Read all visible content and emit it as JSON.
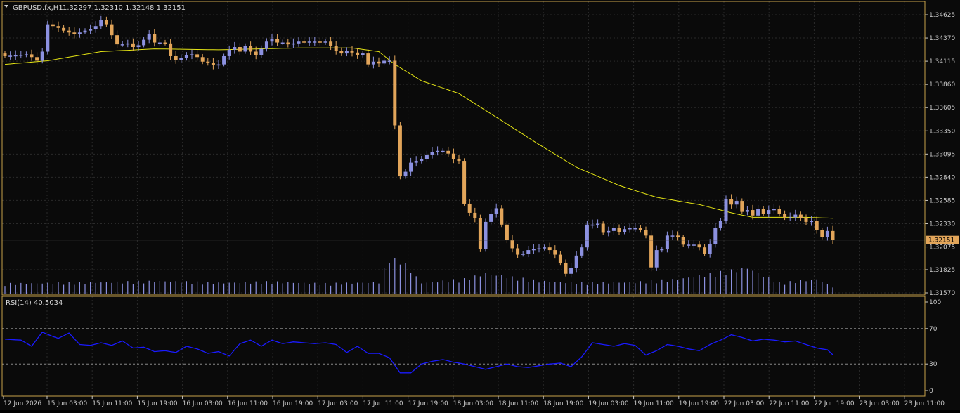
{
  "header": {
    "symbol": "GBPUSD.fx,H1",
    "ohlc": "1.32297 1.32310 1.32148 1.32151"
  },
  "colors": {
    "background": "#0a0a0a",
    "frame": "#c8a24a",
    "grid": "#2b2b2b",
    "axis_text": "#c8c8c8",
    "bull": "#8c91e0",
    "bear": "#e2a55a",
    "ma": "#e6e614",
    "rsi": "#1a1aff",
    "price_line": "#3a3a3a",
    "price_tag_bg": "#e2a55a"
  },
  "chart_data": [
    {
      "type": "candlestick",
      "symbol": "GBPUSD.fx",
      "timeframe": "H1",
      "current_price": "1.32151",
      "y_tick_labels": [
        "1.34625",
        "1.34370",
        "1.34115",
        "1.33860",
        "1.33605",
        "1.33350",
        "1.33095",
        "1.32840",
        "1.32585",
        "1.32330",
        "1.32075",
        "1.31825",
        "1.31570"
      ],
      "ylim": [
        1.3157,
        1.3471
      ],
      "x_tick_labels": [
        "12 Jun 2026",
        "15 Jun 03:00",
        "15 Jun 11:00",
        "15 Jun 19:00",
        "16 Jun 03:00",
        "16 Jun 11:00",
        "16 Jun 19:00",
        "17 Jun 03:00",
        "17 Jun 11:00",
        "17 Jun 19:00",
        "18 Jun 03:00",
        "18 Jun 11:00",
        "18 Jun 19:00",
        "19 Jun 03:00",
        "19 Jun 11:00",
        "19 Jun 19:00",
        "22 Jun 03:00",
        "22 Jun 11:00",
        "22 Jun 19:00",
        "23 Jun 03:00",
        "23 Jun 11:00"
      ],
      "close_path": [
        [
          0,
          1.3417
        ],
        [
          2,
          1.3418
        ],
        [
          4,
          1.3419
        ],
        [
          5,
          1.3416
        ],
        [
          6,
          1.3412
        ],
        [
          7,
          1.3422
        ],
        [
          8,
          1.3452
        ],
        [
          10,
          1.3448
        ],
        [
          11,
          1.3445
        ],
        [
          13,
          1.3441
        ],
        [
          15,
          1.3445
        ],
        [
          16,
          1.3447
        ],
        [
          17,
          1.345
        ],
        [
          18,
          1.3457
        ],
        [
          19,
          1.3452
        ],
        [
          20,
          1.344
        ],
        [
          21,
          1.343
        ],
        [
          22,
          1.343
        ],
        [
          23,
          1.3431
        ],
        [
          24,
          1.3427
        ],
        [
          25,
          1.3429
        ],
        [
          26,
          1.3435
        ],
        [
          27,
          1.3441
        ],
        [
          28,
          1.3432
        ],
        [
          29,
          1.3432
        ],
        [
          30,
          1.3431
        ],
        [
          31,
          1.3417
        ],
        [
          32,
          1.3413
        ],
        [
          33,
          1.3415
        ],
        [
          34,
          1.3418
        ],
        [
          35,
          1.3419
        ],
        [
          36,
          1.3416
        ],
        [
          37,
          1.3411
        ],
        [
          38,
          1.341
        ],
        [
          39,
          1.3407
        ],
        [
          40,
          1.3408
        ],
        [
          41,
          1.3417
        ],
        [
          42,
          1.3424
        ],
        [
          43,
          1.3427
        ],
        [
          44,
          1.3422
        ],
        [
          45,
          1.3428
        ],
        [
          46,
          1.3422
        ],
        [
          47,
          1.3418
        ],
        [
          48,
          1.3425
        ],
        [
          49,
          1.3433
        ],
        [
          50,
          1.3436
        ],
        [
          51,
          1.3432
        ],
        [
          52,
          1.3432
        ],
        [
          53,
          1.343
        ],
        [
          54,
          1.3431
        ],
        [
          55,
          1.3433
        ],
        [
          56,
          1.3432
        ],
        [
          57,
          1.3433
        ],
        [
          58,
          1.3433
        ],
        [
          59,
          1.3432
        ],
        [
          60,
          1.3433
        ],
        [
          61,
          1.3428
        ],
        [
          62,
          1.3423
        ],
        [
          63,
          1.342
        ],
        [
          64,
          1.3423
        ],
        [
          65,
          1.3421
        ],
        [
          66,
          1.3418
        ],
        [
          67,
          1.342
        ],
        [
          68,
          1.3408
        ],
        [
          69,
          1.3411
        ],
        [
          70,
          1.3409
        ],
        [
          71,
          1.3412
        ],
        [
          72,
          1.3412
        ],
        [
          73,
          1.3341
        ],
        [
          74,
          1.3285
        ],
        [
          75,
          1.329
        ],
        [
          76,
          1.33
        ],
        [
          77,
          1.3302
        ],
        [
          78,
          1.3304
        ],
        [
          79,
          1.3309
        ],
        [
          80,
          1.3312
        ],
        [
          81,
          1.3313
        ],
        [
          82,
          1.3313
        ],
        [
          83,
          1.331
        ],
        [
          84,
          1.3304
        ],
        [
          85,
          1.3302
        ],
        [
          86,
          1.3255
        ],
        [
          87,
          1.3245
        ],
        [
          88,
          1.3239
        ],
        [
          89,
          1.3205
        ],
        [
          90,
          1.3235
        ],
        [
          91,
          1.3244
        ],
        [
          92,
          1.325
        ],
        [
          93,
          1.3232
        ],
        [
          94,
          1.3215
        ],
        [
          95,
          1.3206
        ],
        [
          96,
          1.3199
        ],
        [
          97,
          1.32
        ],
        [
          98,
          1.3204
        ],
        [
          99,
          1.3205
        ],
        [
          100,
          1.3206
        ],
        [
          101,
          1.3207
        ],
        [
          102,
          1.3204
        ],
        [
          103,
          1.3199
        ],
        [
          104,
          1.319
        ],
        [
          105,
          1.3178
        ],
        [
          106,
          1.3184
        ],
        [
          107,
          1.3198
        ],
        [
          108,
          1.3207
        ],
        [
          109,
          1.3232
        ],
        [
          110,
          1.3232
        ],
        [
          111,
          1.3233
        ],
        [
          112,
          1.3223
        ],
        [
          113,
          1.3225
        ],
        [
          114,
          1.3228
        ],
        [
          115,
          1.3224
        ],
        [
          116,
          1.3227
        ],
        [
          117,
          1.3228
        ],
        [
          118,
          1.3228
        ],
        [
          119,
          1.3226
        ],
        [
          120,
          1.322
        ],
        [
          121,
          1.3185
        ],
        [
          122,
          1.3204
        ],
        [
          123,
          1.3205
        ],
        [
          124,
          1.322
        ],
        [
          125,
          1.322
        ],
        [
          126,
          1.3218
        ],
        [
          127,
          1.321
        ],
        [
          128,
          1.321
        ],
        [
          129,
          1.321
        ],
        [
          130,
          1.3207
        ],
        [
          131,
          1.32
        ],
        [
          132,
          1.3211
        ],
        [
          133,
          1.3228
        ],
        [
          134,
          1.3236
        ],
        [
          135,
          1.326
        ],
        [
          136,
          1.3254
        ],
        [
          137,
          1.3258
        ],
        [
          138,
          1.3246
        ],
        [
          139,
          1.3248
        ],
        [
          140,
          1.3242
        ],
        [
          141,
          1.3249
        ],
        [
          142,
          1.3244
        ],
        [
          143,
          1.3248
        ],
        [
          144,
          1.3249
        ],
        [
          145,
          1.3244
        ],
        [
          146,
          1.324
        ],
        [
          147,
          1.324
        ],
        [
          148,
          1.3243
        ],
        [
          149,
          1.3239
        ],
        [
          150,
          1.3235
        ],
        [
          151,
          1.3236
        ],
        [
          152,
          1.3226
        ],
        [
          153,
          1.3218
        ],
        [
          154,
          1.3225
        ],
        [
          155,
          1.3215
        ]
      ],
      "ma_path": [
        [
          0,
          1.3408
        ],
        [
          8,
          1.3412
        ],
        [
          18,
          1.3422
        ],
        [
          28,
          1.3425
        ],
        [
          40,
          1.3424
        ],
        [
          55,
          1.3426
        ],
        [
          65,
          1.3426
        ],
        [
          70,
          1.3422
        ],
        [
          73,
          1.3408
        ],
        [
          78,
          1.339
        ],
        [
          85,
          1.3376
        ],
        [
          92,
          1.335
        ],
        [
          100,
          1.332
        ],
        [
          107,
          1.3295
        ],
        [
          115,
          1.3275
        ],
        [
          122,
          1.3262
        ],
        [
          130,
          1.3254
        ],
        [
          136,
          1.3245
        ],
        [
          140,
          1.324
        ],
        [
          150,
          1.324
        ],
        [
          155,
          1.3239
        ]
      ],
      "volume_path": [
        [
          0,
          0.28
        ],
        [
          10,
          0.3
        ],
        [
          20,
          0.32
        ],
        [
          30,
          0.35
        ],
        [
          40,
          0.3
        ],
        [
          50,
          0.33
        ],
        [
          60,
          0.28
        ],
        [
          70,
          0.32
        ],
        [
          72,
          1.0
        ],
        [
          74,
          0.95
        ],
        [
          78,
          0.3
        ],
        [
          86,
          0.4
        ],
        [
          90,
          0.55
        ],
        [
          100,
          0.35
        ],
        [
          107,
          0.3
        ],
        [
          118,
          0.32
        ],
        [
          126,
          0.4
        ],
        [
          135,
          0.6
        ],
        [
          139,
          0.7
        ],
        [
          145,
          0.3
        ],
        [
          152,
          0.4
        ],
        [
          155,
          0.2
        ]
      ]
    },
    {
      "type": "line",
      "indicator": "RSI(14)",
      "label": "RSI(14) 40.5034",
      "value": "40.5034",
      "y_tick_labels": [
        "100",
        "70",
        "30",
        "0"
      ],
      "levels": [
        70,
        30
      ],
      "ylim": [
        0,
        100
      ],
      "rsi_path": [
        [
          0,
          58
        ],
        [
          3,
          57
        ],
        [
          5,
          50
        ],
        [
          7,
          66
        ],
        [
          9,
          61
        ],
        [
          10,
          59
        ],
        [
          12,
          65
        ],
        [
          14,
          52
        ],
        [
          16,
          51
        ],
        [
          18,
          54
        ],
        [
          20,
          51
        ],
        [
          22,
          56
        ],
        [
          24,
          48
        ],
        [
          26,
          49
        ],
        [
          28,
          44
        ],
        [
          30,
          45
        ],
        [
          32,
          43
        ],
        [
          34,
          50
        ],
        [
          36,
          47
        ],
        [
          38,
          42
        ],
        [
          40,
          44
        ],
        [
          42,
          39
        ],
        [
          44,
          53
        ],
        [
          46,
          57
        ],
        [
          48,
          50
        ],
        [
          50,
          57
        ],
        [
          52,
          53
        ],
        [
          54,
          55
        ],
        [
          56,
          54
        ],
        [
          58,
          53
        ],
        [
          60,
          54
        ],
        [
          62,
          52
        ],
        [
          64,
          43
        ],
        [
          66,
          50
        ],
        [
          68,
          42
        ],
        [
          70,
          42
        ],
        [
          72,
          37
        ],
        [
          74,
          20
        ],
        [
          76,
          20
        ],
        [
          78,
          30
        ],
        [
          80,
          33
        ],
        [
          82,
          35
        ],
        [
          84,
          32
        ],
        [
          86,
          30
        ],
        [
          88,
          27
        ],
        [
          90,
          24
        ],
        [
          92,
          27
        ],
        [
          94,
          30
        ],
        [
          96,
          27
        ],
        [
          98,
          26
        ],
        [
          100,
          28
        ],
        [
          102,
          30
        ],
        [
          104,
          31
        ],
        [
          106,
          27
        ],
        [
          108,
          38
        ],
        [
          110,
          54
        ],
        [
          112,
          52
        ],
        [
          114,
          50
        ],
        [
          116,
          53
        ],
        [
          118,
          51
        ],
        [
          120,
          40
        ],
        [
          122,
          45
        ],
        [
          124,
          52
        ],
        [
          126,
          50
        ],
        [
          128,
          47
        ],
        [
          130,
          45
        ],
        [
          132,
          52
        ],
        [
          134,
          57
        ],
        [
          136,
          63
        ],
        [
          138,
          60
        ],
        [
          140,
          56
        ],
        [
          142,
          58
        ],
        [
          144,
          57
        ],
        [
          146,
          55
        ],
        [
          148,
          56
        ],
        [
          150,
          52
        ],
        [
          152,
          48
        ],
        [
          154,
          46
        ],
        [
          155,
          40.5
        ]
      ]
    }
  ]
}
